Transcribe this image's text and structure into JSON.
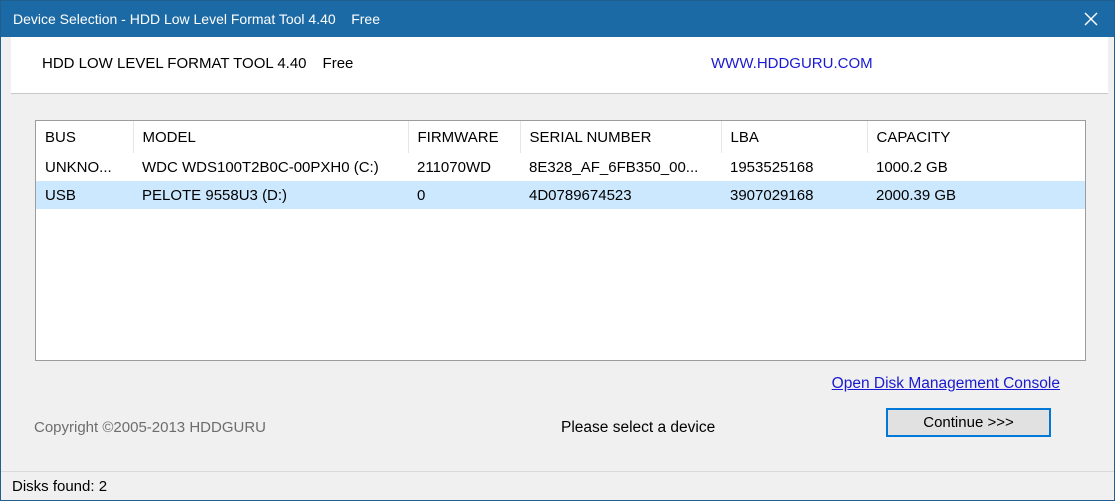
{
  "window": {
    "title": "Device Selection - HDD Low Level Format Tool 4.40    Free",
    "close_glyph": "✕"
  },
  "header": {
    "app_name": "HDD LOW LEVEL FORMAT TOOL 4.40",
    "edition": "Free",
    "website": "WWW.HDDGURU.COM"
  },
  "devices": {
    "columns": [
      "BUS",
      "MODEL",
      "FIRMWARE",
      "SERIAL NUMBER",
      "LBA",
      "CAPACITY"
    ],
    "rows": [
      [
        "UNKNO...",
        "WDC WDS100T2B0C-00PXH0 (C:)",
        "211070WD",
        "8E328_AF_6FB350_00...",
        "1953525168",
        "1000.2 GB"
      ],
      [
        "USB",
        "PELOTE 9558U3 (D:)",
        "0",
        "4D0789674523",
        "3907029168",
        "2000.39 GB"
      ]
    ],
    "selected_row": 1
  },
  "footer": {
    "disk_mgmt_link": "Open Disk Management Console",
    "copyright": "Copyright ©2005-2013 HDDGURU",
    "status_message": "Please select a device",
    "continue_label": "Continue >>>"
  },
  "statusbar": {
    "text": "Disks found: 2"
  },
  "colors": {
    "titlebar": "#1c6aa5",
    "selection": "#cce8ff",
    "link": "#1a1ad0",
    "button_border": "#0078d7"
  }
}
